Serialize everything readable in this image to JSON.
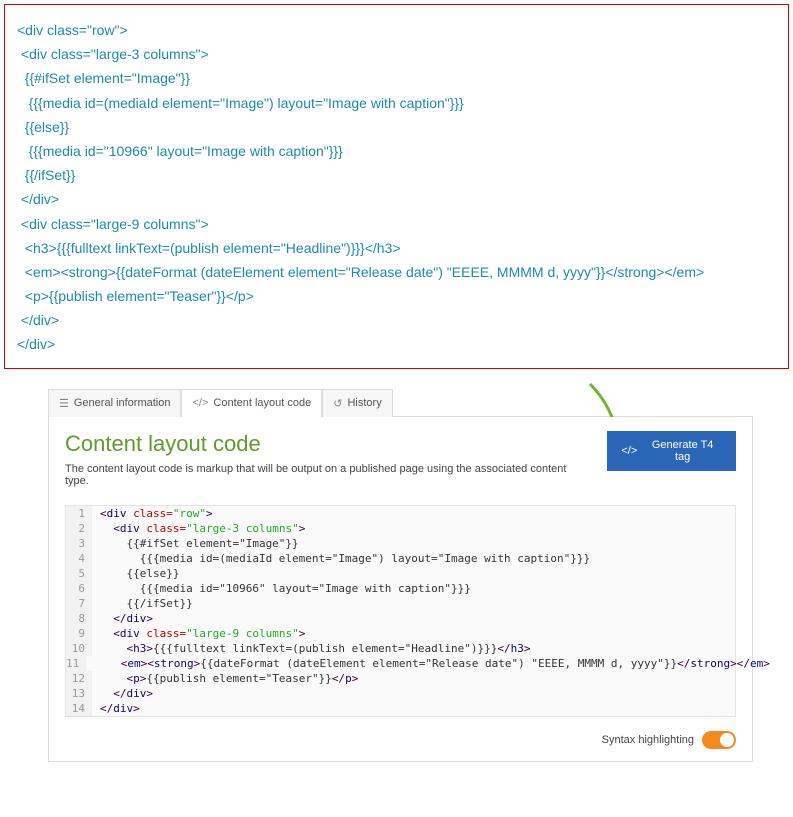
{
  "raw_template": {
    "lines": [
      "<div class=\"row\">",
      " <div class=\"large-3 columns\">",
      "  {{#ifSet element=\"Image\"}}",
      "   {{{media id=(mediaId element=\"Image\") layout=\"Image with caption\"}}}",
      "  {{else}}",
      "   {{{media id=\"10966\" layout=\"Image with caption\"}}}",
      "  {{/ifSet}}",
      " </div>",
      " <div class=\"large-9 columns\">",
      "  <h3>{{{fulltext linkText=(publish element=\"Headline\")}}}</h3>",
      "  <em><strong>{{dateFormat (dateElement element=\"Release date\") \"EEEE, MMMM d, yyyy\"}}</strong></em>",
      "  <p>{{publish element=\"Teaser\"}}</p>",
      " </div>",
      "</div>"
    ]
  },
  "tabs": {
    "general": "General information",
    "code": "Content layout code",
    "history": "History"
  },
  "card": {
    "title": "Content layout code",
    "desc": "The content layout code is markup that will be output on a published page using the associated content type.",
    "button": "Generate T4 tag",
    "syntax_label": "Syntax highlighting"
  },
  "editor_lines": [
    {
      "n": "1",
      "tokens": [
        {
          "c": "pun",
          "t": "<"
        },
        {
          "c": "tagc",
          "t": "div"
        },
        {
          "c": "plain",
          "t": " "
        },
        {
          "c": "attr",
          "t": "class="
        },
        {
          "c": "str",
          "t": "\"row\""
        },
        {
          "c": "pun",
          "t": ">"
        }
      ]
    },
    {
      "n": "2",
      "tokens": [
        {
          "c": "plain",
          "t": "  "
        },
        {
          "c": "pun",
          "t": "<"
        },
        {
          "c": "tagc",
          "t": "div"
        },
        {
          "c": "plain",
          "t": " "
        },
        {
          "c": "attr",
          "t": "class="
        },
        {
          "c": "str",
          "t": "\"large-3 columns\""
        },
        {
          "c": "pun",
          "t": ">"
        }
      ]
    },
    {
      "n": "3",
      "tokens": [
        {
          "c": "plain",
          "t": "    {{#ifSet element=\"Image\"}}"
        }
      ]
    },
    {
      "n": "4",
      "tokens": [
        {
          "c": "plain",
          "t": "      {{{media id=(mediaId element=\"Image\") layout=\"Image with caption\"}}}"
        }
      ]
    },
    {
      "n": "5",
      "tokens": [
        {
          "c": "plain",
          "t": "    {{else}}"
        }
      ]
    },
    {
      "n": "6",
      "tokens": [
        {
          "c": "plain",
          "t": "      {{{media id=\"10966\" layout=\"Image with caption\"}}}"
        }
      ]
    },
    {
      "n": "7",
      "tokens": [
        {
          "c": "plain",
          "t": "    {{/ifSet}}"
        }
      ]
    },
    {
      "n": "8",
      "tokens": [
        {
          "c": "plain",
          "t": "  "
        },
        {
          "c": "pun",
          "t": "</"
        },
        {
          "c": "tagc",
          "t": "div"
        },
        {
          "c": "pun",
          "t": ">"
        }
      ]
    },
    {
      "n": "9",
      "tokens": [
        {
          "c": "plain",
          "t": "  "
        },
        {
          "c": "pun",
          "t": "<"
        },
        {
          "c": "tagc",
          "t": "div"
        },
        {
          "c": "plain",
          "t": " "
        },
        {
          "c": "attr",
          "t": "class="
        },
        {
          "c": "str",
          "t": "\"large-9 columns\""
        },
        {
          "c": "pun",
          "t": ">"
        }
      ]
    },
    {
      "n": "10",
      "tokens": [
        {
          "c": "plain",
          "t": "    "
        },
        {
          "c": "pun",
          "t": "<"
        },
        {
          "c": "tagc",
          "t": "h3"
        },
        {
          "c": "pun",
          "t": ">"
        },
        {
          "c": "plain",
          "t": "{{{fulltext linkText=(publish element=\"Headline\")}}}"
        },
        {
          "c": "pun",
          "t": "</"
        },
        {
          "c": "tagc",
          "t": "h3"
        },
        {
          "c": "pun",
          "t": ">"
        }
      ]
    },
    {
      "n": "11",
      "tokens": [
        {
          "c": "plain",
          "t": "    "
        },
        {
          "c": "pun",
          "t": "<"
        },
        {
          "c": "tagc",
          "t": "em"
        },
        {
          "c": "pun",
          "t": "><"
        },
        {
          "c": "tagc",
          "t": "strong"
        },
        {
          "c": "pun",
          "t": ">"
        },
        {
          "c": "plain",
          "t": "{{dateFormat (dateElement element=\"Release date\") \"EEEE, MMMM d, yyyy\"}}"
        },
        {
          "c": "pun",
          "t": "</"
        },
        {
          "c": "tagc",
          "t": "strong"
        },
        {
          "c": "pun",
          "t": "></"
        },
        {
          "c": "tagc",
          "t": "em"
        },
        {
          "c": "pun",
          "t": ">"
        }
      ]
    },
    {
      "n": "12",
      "tokens": [
        {
          "c": "plain",
          "t": "    "
        },
        {
          "c": "pun",
          "t": "<"
        },
        {
          "c": "tagc",
          "t": "p"
        },
        {
          "c": "pun",
          "t": ">"
        },
        {
          "c": "plain",
          "t": "{{publish element=\"Teaser\"}}"
        },
        {
          "c": "pun",
          "t": "</"
        },
        {
          "c": "tagc",
          "t": "p"
        },
        {
          "c": "pun",
          "t": ">"
        }
      ]
    },
    {
      "n": "13",
      "tokens": [
        {
          "c": "plain",
          "t": "  "
        },
        {
          "c": "pun",
          "t": "</"
        },
        {
          "c": "tagc",
          "t": "div"
        },
        {
          "c": "pun",
          "t": ">"
        }
      ]
    },
    {
      "n": "14",
      "tokens": [
        {
          "c": "pun",
          "t": "</"
        },
        {
          "c": "tagc",
          "t": "div"
        },
        {
          "c": "pun",
          "t": ">"
        }
      ]
    }
  ]
}
